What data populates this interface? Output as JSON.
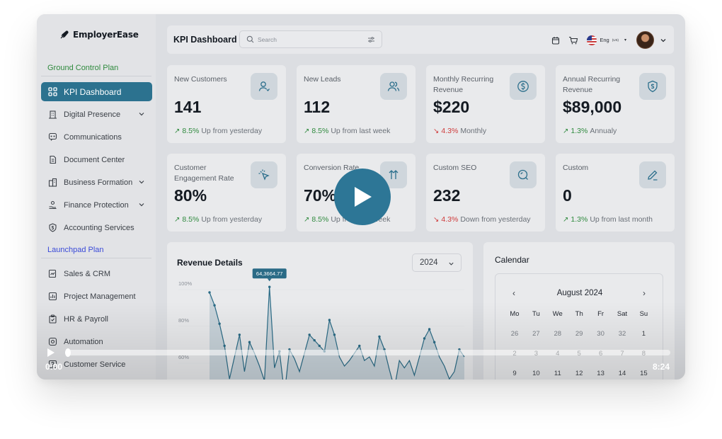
{
  "app": {
    "logo": "EmployerEase"
  },
  "sidebar": {
    "ground_plan": "Ground Control Plan",
    "launch_plan": "Launchpad Plan",
    "items": [
      {
        "label": "KPI Dashboard",
        "icon": "grid-icon",
        "active": true
      },
      {
        "label": "Digital Presence",
        "icon": "building-icon",
        "chevron": true
      },
      {
        "label": "Communications",
        "icon": "chat-icon"
      },
      {
        "label": "Document Center",
        "icon": "document-icon"
      },
      {
        "label": "Business Formation",
        "icon": "office-icon",
        "chevron": true
      },
      {
        "label": "Finance Protection",
        "icon": "hand-coin-icon",
        "chevron": true
      },
      {
        "label": "Accounting Services",
        "icon": "shield-dollar-icon"
      },
      {
        "label": "Sales & CRM",
        "icon": "chart-edit-icon"
      },
      {
        "label": "Project Management",
        "icon": "bar-chart-icon"
      },
      {
        "label": "HR & Payroll",
        "icon": "clipboard-icon"
      },
      {
        "label": "Automation",
        "icon": "gear-icon"
      },
      {
        "label": "Customer Service",
        "icon": "help-icon"
      }
    ]
  },
  "header": {
    "title": "KPI Dashboard",
    "search_placeholder": "Search",
    "lang": "Eng",
    "lang_sub": "(US)"
  },
  "kpis": [
    {
      "label": "New Customers",
      "value": "141",
      "pct": "8.5%",
      "note": "Up from yesterday",
      "dir": "up",
      "icon": "user-icon"
    },
    {
      "label": "New Leads",
      "value": "112",
      "pct": "8.5%",
      "note": "Up from last week",
      "dir": "up",
      "icon": "users-icon"
    },
    {
      "label": "Monthly Recurring Revenue",
      "value": "$220",
      "pct": "4.3%",
      "note": "Monthly",
      "dir": "down",
      "icon": "dollar-circle-icon"
    },
    {
      "label": "Annual Recurring Revenue",
      "value": "$89,000",
      "pct": "1.3%",
      "note": "Annualy",
      "dir": "up",
      "icon": "shield-dollar-icon"
    },
    {
      "label": "Customer Engagement Rate",
      "value": "80%",
      "pct": "8.5%",
      "note": "Up from yesterday",
      "dir": "up",
      "icon": "cursor-click-icon"
    },
    {
      "label": "Conversion Rate",
      "value": "70%",
      "pct": "8.5%",
      "note": "Up from last week",
      "dir": "up",
      "icon": "arrows-up-down-icon"
    },
    {
      "label": "Custom SEO",
      "value": "232",
      "pct": "4.3%",
      "note": "Down from yesterday",
      "dir": "down",
      "icon": "search-icon"
    },
    {
      "label": "Custom",
      "value": "0",
      "pct": "1.3%",
      "note": "Up from last month",
      "dir": "up",
      "icon": "pencil-icon"
    }
  ],
  "revenue": {
    "title": "Revenue Details",
    "year": "2024",
    "y_ticks": [
      "100%",
      "80%",
      "60%"
    ],
    "tooltip": "64,3664.77",
    "points": [
      95,
      88,
      78,
      66,
      48,
      60,
      72,
      52,
      68,
      62,
      55,
      47,
      98,
      54,
      63,
      40,
      64,
      59,
      52,
      62,
      72,
      69,
      66,
      63,
      80,
      72,
      60,
      55,
      58,
      62,
      66,
      58,
      60,
      55,
      71,
      64,
      53,
      43,
      58,
      54,
      58,
      50,
      60,
      70,
      75,
      68,
      60,
      55,
      48,
      52,
      64,
      60
    ]
  },
  "calendar": {
    "title": "Calendar",
    "month": "August 2024",
    "weekdays": [
      "Mo",
      "Tu",
      "We",
      "Th",
      "Fr",
      "Sat",
      "Su"
    ],
    "rows": [
      [
        "26",
        "27",
        "28",
        "29",
        "30",
        "32",
        "1"
      ],
      [
        "2",
        "3",
        "4",
        "5",
        "6",
        "7",
        "8"
      ],
      [
        "9",
        "10",
        "11",
        "12",
        "13",
        "14",
        "15"
      ]
    ]
  },
  "video": {
    "current": "0:00",
    "duration": "8:24",
    "progress": 0.0
  },
  "colors": {
    "accent": "#2c728f",
    "up": "#2f8a3e",
    "down": "#cf3a3a",
    "line": "#2a6b86"
  }
}
